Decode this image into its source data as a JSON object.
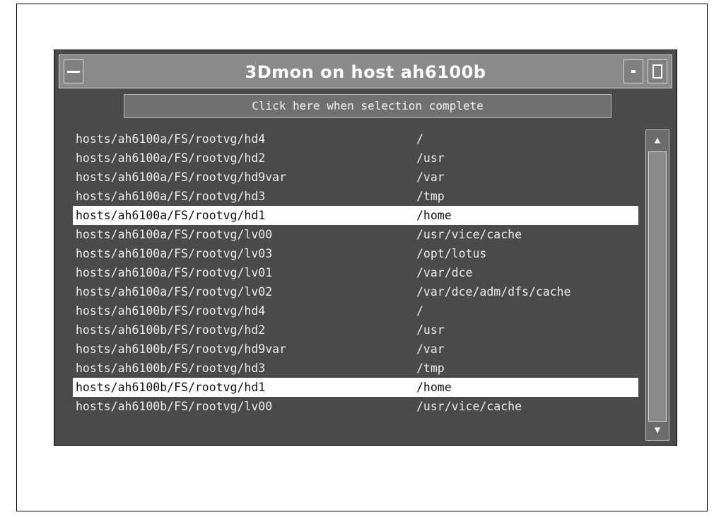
{
  "window": {
    "title": "3Dmon on host ah6100b",
    "action_button_label": "Click here when selection complete"
  },
  "icons": {
    "menu": "window-menu-icon",
    "minimize": "minimize-icon",
    "maximize": "maximize-icon",
    "scroll_up": "scroll-up-icon",
    "scroll_down": "scroll-down-icon"
  },
  "list": {
    "rows": [
      {
        "path": "hosts/ah6100a/FS/rootvg/hd4",
        "mount": "/",
        "selected": false
      },
      {
        "path": "hosts/ah6100a/FS/rootvg/hd2",
        "mount": "/usr",
        "selected": false
      },
      {
        "path": "hosts/ah6100a/FS/rootvg/hd9var",
        "mount": "/var",
        "selected": false
      },
      {
        "path": "hosts/ah6100a/FS/rootvg/hd3",
        "mount": "/tmp",
        "selected": false
      },
      {
        "path": "hosts/ah6100a/FS/rootvg/hd1",
        "mount": "/home",
        "selected": true
      },
      {
        "path": "hosts/ah6100a/FS/rootvg/lv00",
        "mount": "/usr/vice/cache",
        "selected": false
      },
      {
        "path": "hosts/ah6100a/FS/rootvg/lv03",
        "mount": "/opt/lotus",
        "selected": false
      },
      {
        "path": "hosts/ah6100a/FS/rootvg/lv01",
        "mount": "/var/dce",
        "selected": false
      },
      {
        "path": "hosts/ah6100a/FS/rootvg/lv02",
        "mount": "/var/dce/adm/dfs/cache",
        "selected": false
      },
      {
        "path": "hosts/ah6100b/FS/rootvg/hd4",
        "mount": "/",
        "selected": false
      },
      {
        "path": "hosts/ah6100b/FS/rootvg/hd2",
        "mount": "/usr",
        "selected": false
      },
      {
        "path": "hosts/ah6100b/FS/rootvg/hd9var",
        "mount": "/var",
        "selected": false
      },
      {
        "path": "hosts/ah6100b/FS/rootvg/hd3",
        "mount": "/tmp",
        "selected": false
      },
      {
        "path": "hosts/ah6100b/FS/rootvg/hd1",
        "mount": "/home",
        "selected": true
      },
      {
        "path": "hosts/ah6100b/FS/rootvg/lv00",
        "mount": "/usr/vice/cache",
        "selected": false
      }
    ]
  }
}
